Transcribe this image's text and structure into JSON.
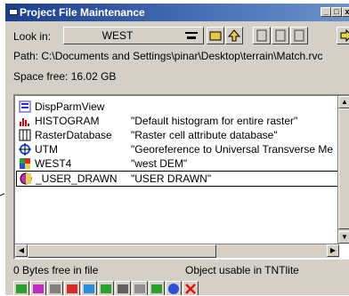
{
  "window": {
    "title": "Project File Maintenance"
  },
  "lookin": {
    "label": "Look in:",
    "value": "WEST"
  },
  "path": {
    "label": "Path:",
    "value": "C:\\Documents and Settings\\pinar\\Desktop\\terrain\\Match.rvc"
  },
  "space": {
    "label": "Space free:",
    "value": "16.02 GB"
  },
  "objects": [
    {
      "name": "DispParmView",
      "desc": "",
      "icon": "display-parms-icon"
    },
    {
      "name": "HISTOGRAM",
      "desc": "\"Default histogram for entire raster\"",
      "icon": "histogram-icon"
    },
    {
      "name": "RasterDatabase",
      "desc": "\"Raster cell attribute database\"",
      "icon": "database-icon"
    },
    {
      "name": "UTM",
      "desc": "\"Georeference to Universal Transverse Me",
      "icon": "georeference-icon"
    },
    {
      "name": "WEST4",
      "desc": "\"west DEM\"",
      "icon": "raster-icon"
    },
    {
      "name": "_USER_DRAWN",
      "desc": "\"USER DRAWN\"",
      "icon": "user-drawn-icon"
    }
  ],
  "status": {
    "bytes_free": "0 Bytes free in file",
    "usable": "Object usable in TNTlite"
  },
  "colors": {
    "title_start": "#1b3d8a",
    "title_end": "#6d93c9",
    "face": "#d4d0c8"
  }
}
